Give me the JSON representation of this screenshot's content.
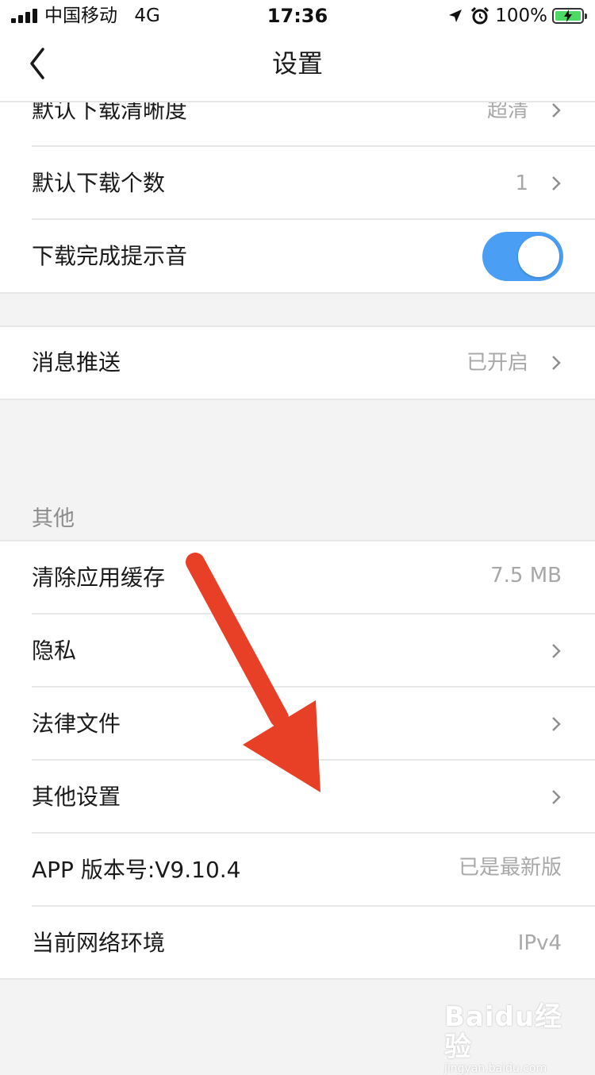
{
  "status_bar": {
    "carrier": "中国移动",
    "network": "4G",
    "time": "17:36",
    "battery": "100%",
    "icons": [
      "signal-icon",
      "location-arrow-icon",
      "alarm-icon",
      "battery-charging-icon"
    ]
  },
  "nav": {
    "title": "设置",
    "back_icon": "chevron-left-icon"
  },
  "download_group": [
    {
      "label": "默认下载清晰度",
      "value": "超清"
    },
    {
      "label": "默认下载个数",
      "value": "1"
    },
    {
      "label": "下载完成提示音",
      "toggle_on": true
    }
  ],
  "push_group": [
    {
      "label": "消息推送",
      "value": "已开启"
    }
  ],
  "other_section": {
    "header": "其他",
    "rows": [
      {
        "label": "清除应用缓存",
        "value": "7.5 MB"
      },
      {
        "label": "隐私"
      },
      {
        "label": "法律文件"
      },
      {
        "label": "其他设置"
      },
      {
        "label": "APP 版本号:V9.10.4",
        "value": "已是最新版"
      },
      {
        "label": "当前网络环境",
        "value": "IPv4"
      }
    ]
  },
  "colors": {
    "toggle_on": "#4a9ff5",
    "annotation_arrow": "#e84027",
    "page_background": "#f3f3f3"
  },
  "watermark": {
    "logo": "Baidu经验",
    "sub": "jingyan.baidu.com"
  }
}
